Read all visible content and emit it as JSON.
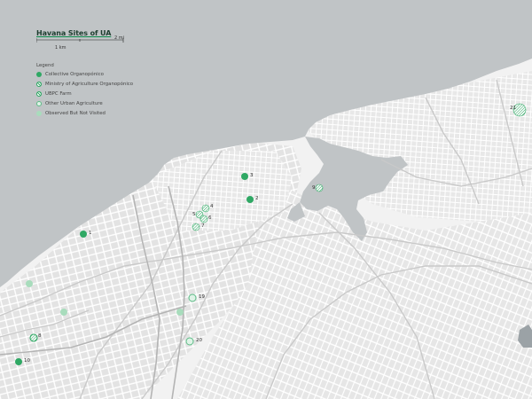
{
  "map": {
    "title": "Havana Sites of UA",
    "scale": {
      "label_km": "1 km",
      "label_mi": "2 mi"
    },
    "legend": {
      "title": "Legend",
      "items": [
        {
          "label": "Collective Organopónico",
          "style": "solid",
          "color": "#2fa864"
        },
        {
          "label": "Ministry of Agriculture Organopónico",
          "style": "hatch",
          "color": "#2fa864"
        },
        {
          "label": "UBPC Farm",
          "style": "hatch-ring",
          "color": "#2fa864"
        },
        {
          "label": "Other Urban Agriculture",
          "style": "light-ring",
          "color": "#5cbc86"
        },
        {
          "label": "Observed But Not Visited",
          "style": "pale",
          "color": "#8fd3ac"
        }
      ]
    },
    "sites": [
      {
        "label": "1",
        "style": "solid"
      },
      {
        "label": "2",
        "style": "solid"
      },
      {
        "label": "3",
        "style": "solid"
      },
      {
        "label": "4",
        "style": "hatch"
      },
      {
        "label": "5",
        "style": "hatch"
      },
      {
        "label": "6",
        "style": "hatch"
      },
      {
        "label": "7",
        "style": "hatch"
      },
      {
        "label": "8",
        "style": "hatch-ring"
      },
      {
        "label": "9",
        "style": "hatch"
      },
      {
        "label": "10",
        "style": "solid"
      },
      {
        "label": "19",
        "style": "light-ring"
      },
      {
        "label": "20",
        "style": "light-ring"
      },
      {
        "label": "21",
        "style": "hatch"
      }
    ],
    "unlabeled_sites": [
      {
        "style": "pale"
      },
      {
        "style": "pale"
      },
      {
        "style": "pale"
      }
    ],
    "colors": {
      "water": "#c0c4c6",
      "land": "#f2f2f2",
      "street": "#ffffff",
      "block": "#e3e3e3",
      "accent": "#2fa864"
    }
  }
}
